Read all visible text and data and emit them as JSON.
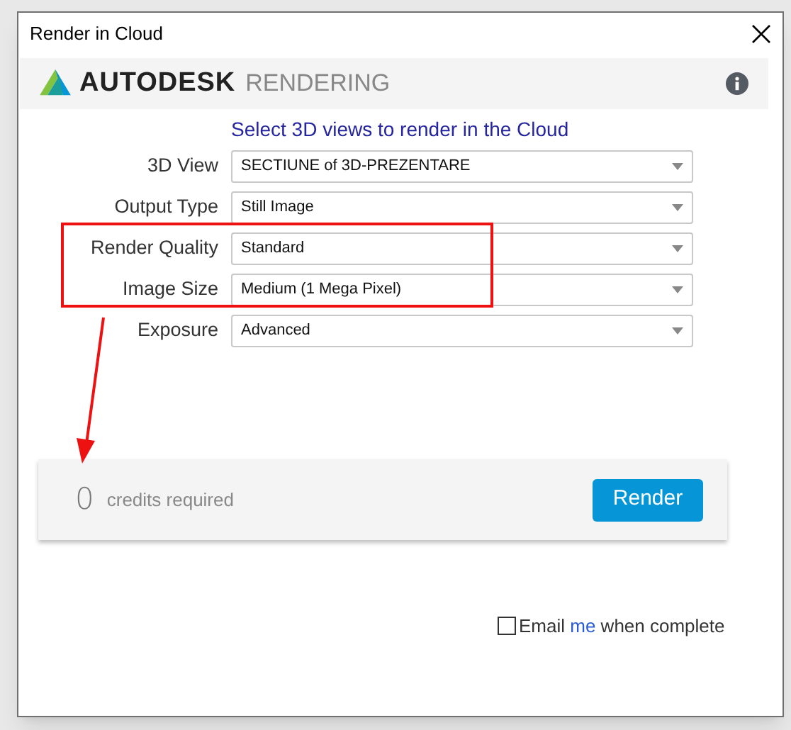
{
  "window": {
    "title": "Render in Cloud"
  },
  "header": {
    "brand": "AUTODESK",
    "product": "RENDERING"
  },
  "instruction": "Select 3D views to render in the Cloud",
  "fields": [
    {
      "label": "3D View",
      "value": "SECTIUNE of 3D-PREZENTARE"
    },
    {
      "label": "Output Type",
      "value": "Still Image"
    },
    {
      "label": "Render Quality",
      "value": "Standard"
    },
    {
      "label": "Image Size",
      "value": "Medium (1 Mega Pixel)"
    },
    {
      "label": "Exposure",
      "value": "Advanced"
    }
  ],
  "credits": {
    "count": "0",
    "label": "credits required",
    "button": "Render"
  },
  "email": {
    "before": "Email ",
    "link": "me",
    "after": " when complete",
    "checked": false
  }
}
